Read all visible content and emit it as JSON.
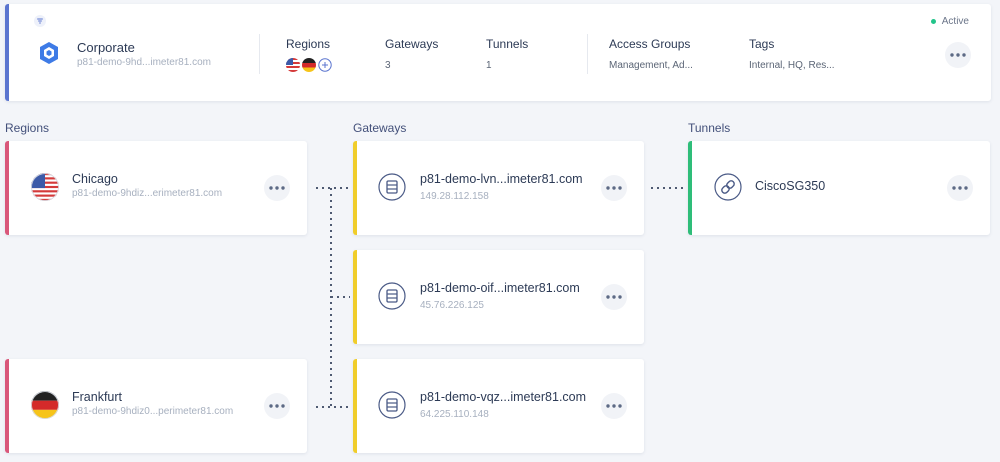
{
  "colors": {
    "org_accent": "#5b75cf",
    "region_accent": "#d9577a",
    "gateway_accent": "#f0cd2a",
    "tunnel_accent": "#2ebd79",
    "status_dot": "#22c48a"
  },
  "network": {
    "name": "Corporate",
    "domain": "p81-demo-9hd...imeter81.com",
    "status": "Active",
    "columns": {
      "regions_label": "Regions",
      "gateways_label": "Gateways",
      "gateways_value": "3",
      "tunnels_label": "Tunnels",
      "tunnels_value": "1",
      "access_groups_label": "Access Groups",
      "access_groups_value": "Management, Ad...",
      "tags_label": "Tags",
      "tags_value": "Internal, HQ, Res..."
    }
  },
  "sections": {
    "regions": "Regions",
    "gateways": "Gateways",
    "tunnels": "Tunnels"
  },
  "regions": [
    {
      "name": "Chicago",
      "domain": "p81-demo-9hdiz...erimeter81.com",
      "flag": "us-flag"
    },
    {
      "name": "Frankfurt",
      "domain": "p81-demo-9hdiz0...perimeter81.com",
      "flag": "germany-flag"
    }
  ],
  "gateways": [
    {
      "name": "p81-demo-lvn...imeter81.com",
      "ip": "149.28.112.158"
    },
    {
      "name": "p81-demo-oif...imeter81.com",
      "ip": "45.76.226.125"
    },
    {
      "name": "p81-demo-vqz...imeter81.com",
      "ip": "64.225.110.148"
    }
  ],
  "tunnels": [
    {
      "name": "CiscoSG350"
    }
  ]
}
